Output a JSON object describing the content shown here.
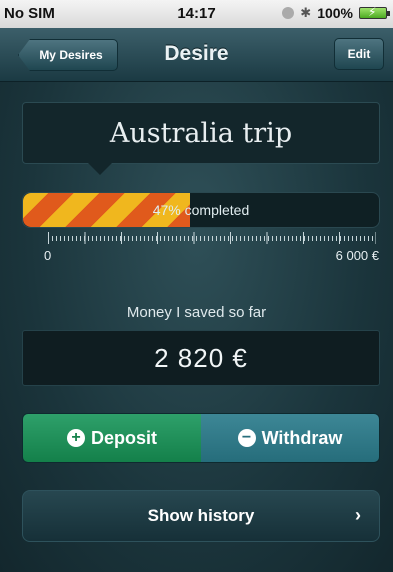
{
  "status_bar": {
    "carrier": "No SIM",
    "time": "14:17",
    "battery": "100%"
  },
  "nav": {
    "back_label": "My Desires",
    "title": "Desire",
    "edit_label": "Edit"
  },
  "desire": {
    "name": "Australia trip",
    "progress_percent": 47,
    "progress_text": "47% completed",
    "scale_min": "0",
    "scale_max": "6 000 €",
    "saved_label": "Money I saved so far",
    "saved_amount": "2 820 €"
  },
  "actions": {
    "deposit_label": "Deposit",
    "withdraw_label": "Withdraw",
    "history_label": "Show history"
  },
  "colors": {
    "deposit": "#14804a",
    "withdraw": "#266d7b",
    "progress_orange": "#e05a1c",
    "progress_yellow": "#f0b71e"
  }
}
